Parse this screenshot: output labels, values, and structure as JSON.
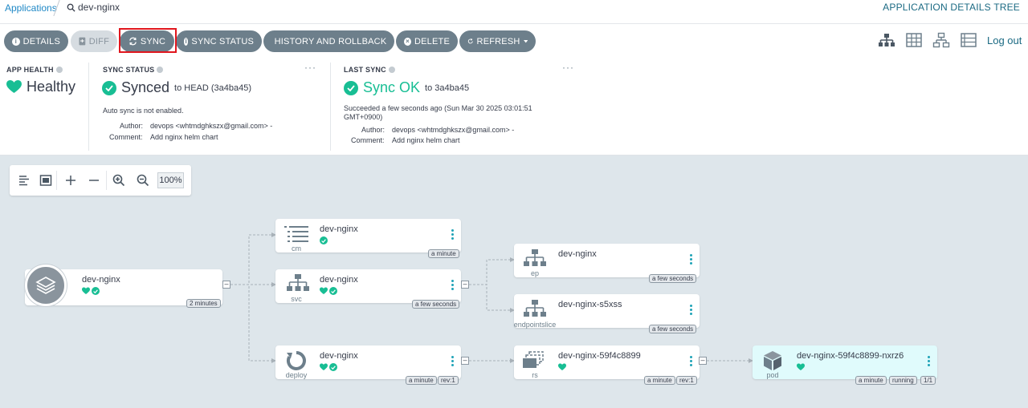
{
  "breadcrumb": {
    "applications": "Applications",
    "current": "dev-nginx"
  },
  "header": {
    "title": "APPLICATION DETAILS TREE",
    "logout": "Log out"
  },
  "toolbar": {
    "details": "DETAILS",
    "diff": "DIFF",
    "sync": "SYNC",
    "sync_status": "SYNC STATUS",
    "history": "HISTORY AND ROLLBACK",
    "delete": "DELETE",
    "refresh": "REFRESH"
  },
  "view_icons": [
    "tree-view-icon",
    "pods-view-icon",
    "network-view-icon",
    "list-view-icon"
  ],
  "app_health": {
    "label": "APP HEALTH",
    "value": "Healthy"
  },
  "sync_status": {
    "label": "SYNC STATUS",
    "value": "Synced",
    "to": "to HEAD (3a4ba45)",
    "auto_sync": "Auto sync is not enabled.",
    "author_label": "Author:",
    "author": "devops <whtmdghkszx@gmail.com> -",
    "comment_label": "Comment:",
    "comment": "Add nginx helm chart"
  },
  "last_sync": {
    "label": "LAST SYNC",
    "value": "Sync OK",
    "to": "to 3a4ba45",
    "succeeded_line1": "Succeeded a few seconds ago (Sun Mar 30 2025 03:01:51",
    "succeeded_line2": "GMT+0900)",
    "author_label": "Author:",
    "author": "devops <whtmdghkszx@gmail.com> -",
    "comment_label": "Comment:",
    "comment": "Add nginx helm chart"
  },
  "zoom": {
    "value": "100%"
  },
  "tree": {
    "app": {
      "name": "dev-nginx",
      "age": "2 minutes"
    },
    "cm": {
      "name": "dev-nginx",
      "kind": "cm",
      "age": "a minute"
    },
    "svc": {
      "name": "dev-nginx",
      "kind": "svc",
      "age": "a few seconds"
    },
    "deploy": {
      "name": "dev-nginx",
      "kind": "deploy",
      "age": "a minute",
      "rev": "rev:1"
    },
    "ep": {
      "name": "dev-nginx",
      "kind": "ep",
      "age": "a few seconds"
    },
    "endpointslice": {
      "name": "dev-nginx-s5xss",
      "kind": "endpointslice",
      "age": "a few seconds"
    },
    "rs": {
      "name": "dev-nginx-59f4c8899",
      "kind": "rs",
      "age": "a minute",
      "rev": "rev:1"
    },
    "pod": {
      "name": "dev-nginx-59f4c8899-nxrz6",
      "kind": "pod",
      "age": "a minute",
      "state": "running",
      "ready": "1/1"
    }
  },
  "colors": {
    "healthy": "#18be94",
    "accent": "#1b6a83",
    "button": "#6d7f8b",
    "highlight": "#e0161e",
    "canvas": "#dee6eb"
  }
}
